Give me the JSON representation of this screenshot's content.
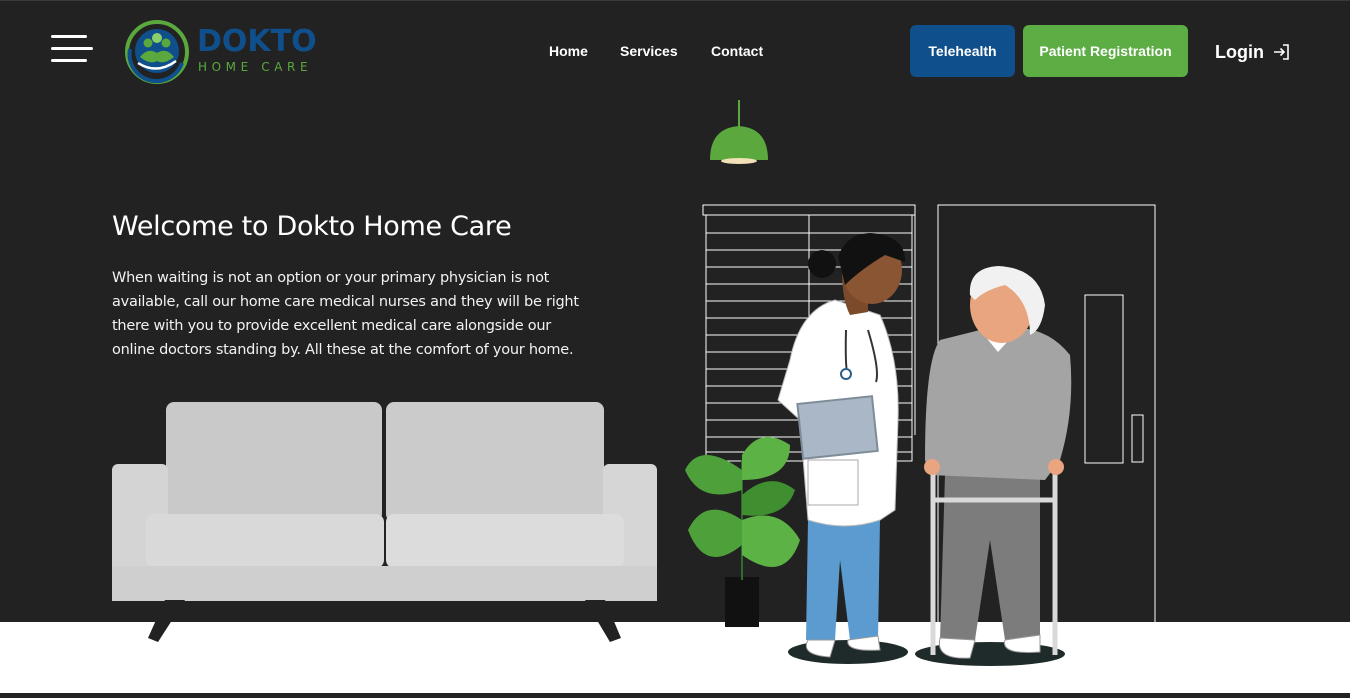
{
  "header": {
    "menu_icon": "hamburger-menu-icon",
    "logo": {
      "name": "DOKTO",
      "tagline": "HOME CARE"
    },
    "nav": [
      {
        "label": "Home"
      },
      {
        "label": "Services"
      },
      {
        "label": "Contact"
      }
    ],
    "telehealth_label": "Telehealth",
    "registration_label": "Patient Registration",
    "login_label": "Login",
    "login_icon": "sign-in-arrow-icon"
  },
  "hero": {
    "title": "Welcome to Dokto Home Care",
    "description": "When waiting is not an option or your primary physician is not available, call our home care medical nurses and they will be right there with you to provide excellent medical care alongside our online doctors standing by. All these at the comfort of your home."
  },
  "colors": {
    "background": "#222222",
    "brand_blue": "#0f4f8c",
    "brand_green": "#5cad44",
    "text": "#ffffff"
  }
}
